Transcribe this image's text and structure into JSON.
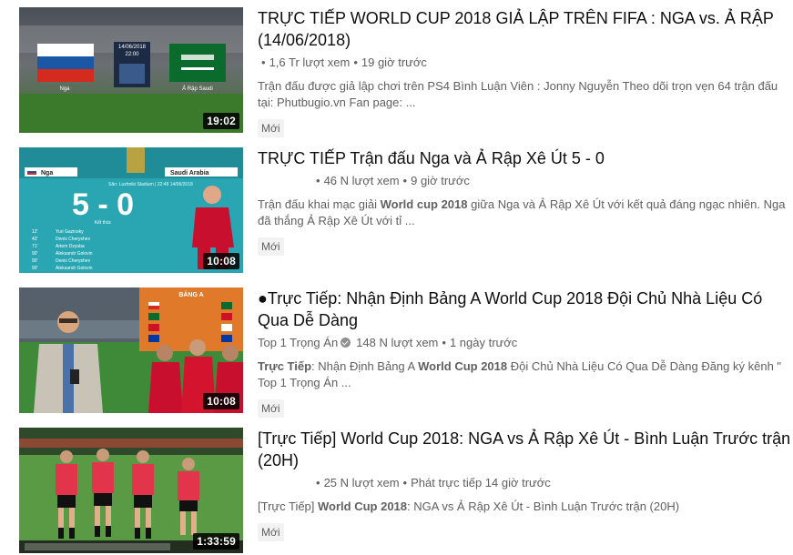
{
  "results": [
    {
      "title": "TRỰC TIẾP WORLD CUP 2018 GIẢ LẬP TRÊN FIFA : NGA vs. Ả RẬP (14/06/2018)",
      "channel": "",
      "views": "1,6 Tr lượt xem",
      "time": "19 giờ trước",
      "description_parts": [
        {
          "text": "Trận đấu được giả lập chơi trên PS4 Bình Luận Viên : Jonny Nguyễn Theo dõi trọn vẹn 64 trận đấu tại: Phutbugio.vn Fan page: ...",
          "bold": false
        }
      ],
      "badge": "Mới",
      "duration": "19:02",
      "thumb": {
        "date": "14/06/2018",
        "time": "22:00",
        "left_team": "Nga",
        "right_team": "Ả Rập Saudi"
      }
    },
    {
      "title": "TRỰC TIẾP Trận đấu Nga và Ả Rập Xê Út 5 - 0",
      "channel": "",
      "views": "46 N lượt xem",
      "time": "9 giờ trước",
      "description_parts": [
        {
          "text": "Trận đấu khai mạc giải ",
          "bold": false
        },
        {
          "text": "World cup 2018",
          "bold": true
        },
        {
          "text": " giữa Nga và Ả Rập Xê Út với kết quả đáng ngạc nhiên. Nga đã thắng Ả Rập Xê Út với tỉ ...",
          "bold": false
        }
      ],
      "badge": "Mới",
      "duration": "10:08",
      "thumb": {
        "left_team": "Nga",
        "right_team": "Saudi Arabia",
        "score": "5 - 0",
        "stadium": "Sân: Luzhniki Stadium | 22:49 14/06/2018",
        "label": "Kết thúc",
        "scorers": [
          "Yuri Gazinsky",
          "Denis Cheryshev",
          "Artem Dzyuba",
          "Aleksandr Golovin",
          "Denis Cheryshev",
          "Aleksandr Golovin"
        ],
        "minutes": [
          "12'",
          "43'",
          "71'",
          "90'",
          "90'",
          "90'"
        ]
      }
    },
    {
      "title": "●Trực Tiếp: Nhận Định Bảng A World Cup 2018 Đội Chủ Nhà Liệu Có Qua Dễ Dàng",
      "channel": "Top 1 Trọng Án",
      "views": "148 N lượt xem",
      "time": "1 ngày trước",
      "description_parts": [
        {
          "text": "Trực Tiếp",
          "bold": true
        },
        {
          "text": ": Nhận Định Bảng A ",
          "bold": false
        },
        {
          "text": "World Cup 2018",
          "bold": true
        },
        {
          "text": " Đội Chủ Nhà Liệu Có Qua Dễ Dàng Đăng ký kênh \" Top 1 Trọng Án ...",
          "bold": false
        }
      ],
      "badge": "Mới",
      "duration": "10:08",
      "thumb": {
        "panel_title": "BẢNG A"
      }
    },
    {
      "title": "[Trực Tiếp] World Cup 2018: NGA vs Ả Rập Xê Út - Bình Luận Trước trận (20H)",
      "channel": "",
      "views": "25 N lượt xem",
      "time": "Phát trực tiếp 14 giờ trước",
      "description_parts": [
        {
          "text": "[Trực Tiếp] ",
          "bold": false
        },
        {
          "text": "World Cup 2018",
          "bold": true
        },
        {
          "text": ": NGA vs Ả Rập Xê Út - Bình Luận Trước trận (20H)",
          "bold": false
        }
      ],
      "badge": "Mới",
      "duration": "1:33:59",
      "thumb": {}
    }
  ],
  "icons": {
    "verified": "verified-check-icon"
  },
  "colors": {
    "meta": "#606060",
    "title": "#0f0f0f",
    "badge_bg": "#f2f2f2"
  }
}
